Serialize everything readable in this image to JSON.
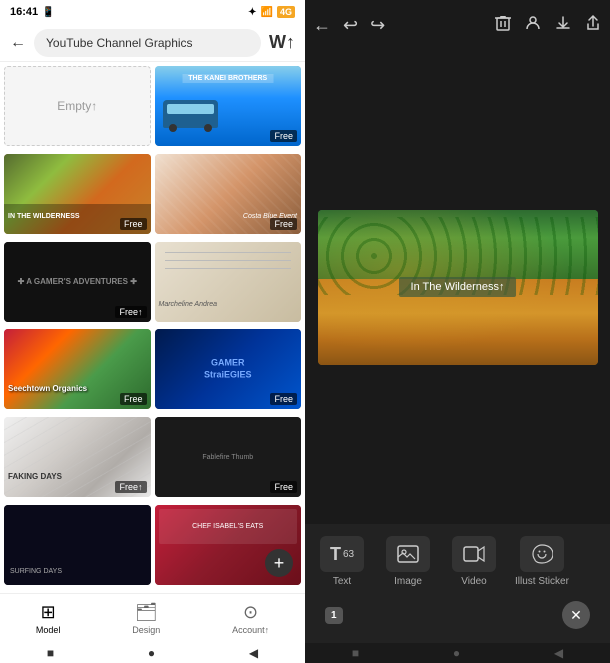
{
  "left": {
    "statusBar": {
      "time": "16:41",
      "batteryIcon": "🔋",
      "wifiIcon": "📶",
      "btIcon": "✦"
    },
    "searchBar": {
      "backIcon": "←",
      "placeholder": "YouTube Channel Graphics",
      "wIcon": "W↑"
    },
    "templates": [
      {
        "id": "empty",
        "label": "Empty↑",
        "type": "empty"
      },
      {
        "id": "kanei",
        "label": "THE KANEI BROTHERS",
        "badge": "Free",
        "type": "kanei"
      },
      {
        "id": "wilderness",
        "label": "IN THE WILDERNESS",
        "badge": "Free",
        "type": "forest"
      },
      {
        "id": "fashion",
        "label": "Costa Blue Event",
        "badge": "Free",
        "type": "fashion"
      },
      {
        "id": "gamer-adv",
        "label": "A GAMER'S ADVENTURES",
        "badge": "Free↑",
        "type": "dark"
      },
      {
        "id": "notebook",
        "label": "Marcheline Andrea",
        "badge": "",
        "type": "notebook"
      },
      {
        "id": "fruits",
        "label": "Seechtown Organics",
        "badge": "Free",
        "type": "fruits"
      },
      {
        "id": "gamer-strat",
        "label": "GAMER StraiEGIES",
        "badge": "Free",
        "type": "gamer"
      },
      {
        "id": "marble",
        "label": "FAKING DAYS",
        "badge": "Free↑",
        "type": "marble"
      },
      {
        "id": "dark2",
        "label": "Fablefire Thumb",
        "badge": "Free",
        "type": "dark2"
      },
      {
        "id": "dark3",
        "label": "",
        "badge": "",
        "type": "dark3"
      },
      {
        "id": "berries",
        "label": "CHEF ISABEL'S EATS",
        "badge": "",
        "type": "berries",
        "hasPlus": true
      }
    ],
    "bottomNav": [
      {
        "id": "model",
        "label": "Model",
        "icon": "⊞",
        "active": true
      },
      {
        "id": "design",
        "label": "Design",
        "icon": "🗂",
        "active": false
      },
      {
        "id": "account",
        "label": "Account↑",
        "icon": "⊙",
        "active": false
      }
    ],
    "systemNav": [
      "■",
      "●",
      "◀"
    ]
  },
  "right": {
    "toolbar": {
      "backIcon": "←",
      "undoIcon": "↩",
      "redoIcon": "↪",
      "trashIcon": "🗑",
      "profileIcon": "👤",
      "downloadIcon": "⬇",
      "shareIcon": "⬆"
    },
    "canvas": {
      "imageText": "In The Wilderness↑"
    },
    "tools": [
      {
        "id": "text",
        "icon": "T",
        "label": "Text",
        "fontSize": "63"
      },
      {
        "id": "image",
        "icon": "▭",
        "label": "Image"
      },
      {
        "id": "video",
        "icon": "▶",
        "label": "Video"
      },
      {
        "id": "illust",
        "icon": "✿",
        "label": "Illust Sticker"
      }
    ],
    "pageIndicator": "1",
    "closeBtn": "✕",
    "systemNav": [
      "■",
      "●",
      "◀"
    ]
  }
}
